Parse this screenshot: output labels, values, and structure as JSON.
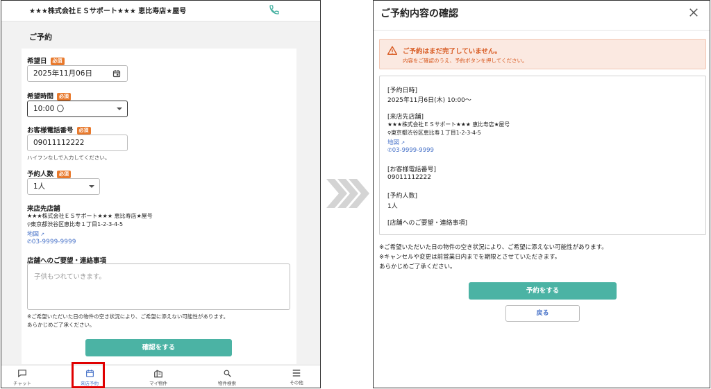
{
  "phone": {
    "header": {
      "shop_name": "★★★株式会社ＥＳサポート★★★ 恵比寿店★屋号"
    },
    "section_title": "ご予約",
    "required_badge": "必須",
    "date": {
      "label": "希望日",
      "value": "2025年11月06日"
    },
    "time": {
      "label": "希望時間",
      "value": "10:00 〇"
    },
    "phone_number": {
      "label": "お客様電話番号",
      "value": "09011112222",
      "hint": "ハイフンなしで入力してください。"
    },
    "people": {
      "label": "予約人数",
      "value": "1人"
    },
    "store": {
      "label": "来店先店舗",
      "name": "★★★株式会社ＥＳサポート★★★ 恵比寿店★屋号",
      "address": "東京都渋谷区恵比寿１丁目1-2-3-4-5",
      "map_link": "地図",
      "tel": "03-9999-9999"
    },
    "request": {
      "label": "店舗へのご要望・連絡事項",
      "placeholder": "子供もつれていきます。"
    },
    "notes": [
      "※ご希望いただいた日の物件の空き状況により、ご希望に添えない可能性があります。",
      "あらかじめご了承ください。"
    ],
    "confirm_button": "確認をする",
    "tabs": [
      {
        "label": "チャット",
        "icon": "chat-icon",
        "active": false
      },
      {
        "label": "来店予約",
        "icon": "calendar-icon",
        "active": true
      },
      {
        "label": "マイ物件",
        "icon": "building-icon",
        "active": false
      },
      {
        "label": "物件検索",
        "icon": "search-icon",
        "active": false
      },
      {
        "label": "その他",
        "icon": "menu-icon",
        "active": false
      }
    ]
  },
  "modal": {
    "title": "ご予約内容の確認",
    "warning": {
      "title": "ご予約はまだ完了していません。",
      "subtitle": "内容をご確認のうえ、予約ボタンを押してください。"
    },
    "summary": {
      "datetime_label": "[予約日時]",
      "datetime_value": "2025年11月6日(木) 10:00〜",
      "store_label": "[来店先店舗]",
      "store_name": "★★★株式会社ＥＳサポート★★★ 恵比寿店★屋号",
      "store_address": "東京都渋谷区恵比寿１丁目1-2-3-4-5",
      "map_link": "地図",
      "tel": "03-9999-9999",
      "phone_label": "[お客様電話番号]",
      "phone_value": "09011112222",
      "people_label": "[予約人数]",
      "people_value": "1人",
      "request_label": "[店舗へのご要望・連絡事項]"
    },
    "notes": [
      "※ご希望いただいた日の物件の空き状況により、ご希望に添えない可能性があります。",
      "※キャンセルや変更は前営業日内までを期限とさせていただきます。",
      "あらかじめご了承ください。"
    ],
    "book_button": "予約をする",
    "back_button": "戻る"
  },
  "colors": {
    "accent": "#4bb3a4",
    "link": "#4a74c9",
    "required": "#e8792c",
    "warning": "#d85a21",
    "highlight": "#e00000"
  }
}
